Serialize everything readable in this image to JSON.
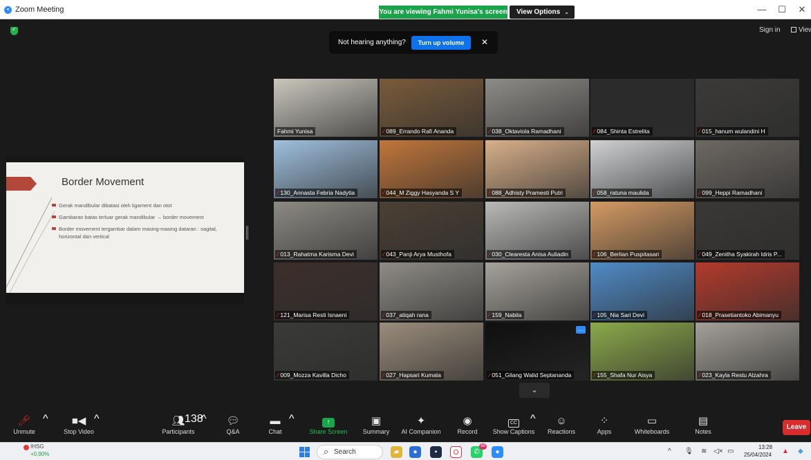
{
  "window": {
    "title": "Zoom Meeting",
    "minimize": "—",
    "maximize": "☐",
    "close": "✕"
  },
  "banner": {
    "viewing_text": "You are viewing Fahmi Yunisa's screen",
    "view_options_label": "View Options",
    "view_options_caret": "⌄"
  },
  "header": {
    "sign_in": "Sign in",
    "view": "View"
  },
  "notice": {
    "message": "Not hearing anything?",
    "button": "Turn up volume",
    "close": "✕"
  },
  "slide": {
    "title": "Border Movement",
    "bullets": [
      "Gerak mandibular dibatasi oleh ligament dan otot",
      "Gambaran batas terluar gerak mandibular → border movement",
      "Border movement tergambar dalam masing-masing dataran : sagital, horizontal dan vertical"
    ]
  },
  "participants": [
    {
      "name": "Fahmi Yunisa",
      "muted": false,
      "color": "#c9c6bd"
    },
    {
      "name": "089_Errando Rafi Ananda",
      "muted": true,
      "color": "#7a5b3b"
    },
    {
      "name": "038_Oktaviola Ramadhani",
      "muted": true,
      "color": "#8e8c88"
    },
    {
      "name": "084_Shinta Estrelita",
      "muted": true,
      "color": "#2b2b2b"
    },
    {
      "name": "015_hanum wulandini H",
      "muted": true,
      "color": "#3b3a38"
    },
    {
      "name": "130_Annasta Febria Nadytia",
      "muted": true,
      "color": "#9fc0de"
    },
    {
      "name": "044_M Ziggy Hasyanda S Y",
      "muted": true,
      "color": "#c1763a"
    },
    {
      "name": "088_Adhisty Pramesti Putri",
      "muted": true,
      "color": "#d9b08a"
    },
    {
      "name": "058_ratuna maulida",
      "muted": true,
      "color": "#cfd1d3"
    },
    {
      "name": "099_Heppi Ramadhani",
      "muted": true,
      "color": "#6d6863"
    },
    {
      "name": "013_Rahatma Karisma Devi",
      "muted": true,
      "color": "#8d8a84"
    },
    {
      "name": "043_Panji Arya Musthofa",
      "muted": true,
      "color": "#4b4034"
    },
    {
      "name": "030_Clearesta Anisa Auliadin",
      "muted": true,
      "color": "#b9b9b8"
    },
    {
      "name": "106_Berlian Puspitasari",
      "muted": true,
      "color": "#d49a63"
    },
    {
      "name": "049_Zenitha Syakirah Idris P...",
      "muted": true,
      "color": "#3a3836"
    },
    {
      "name": "121_Marisa Resti Isnaeni",
      "muted": true,
      "color": "#3d2f2b"
    },
    {
      "name": "037_atiqah rana",
      "muted": true,
      "color": "#8f8c86"
    },
    {
      "name": "159_Nabila",
      "muted": true,
      "color": "#a6a29b"
    },
    {
      "name": "105_Nia Sari Devi",
      "muted": true,
      "color": "#4f8bc7"
    },
    {
      "name": "018_Prasetiantoko Abimanyu",
      "muted": true,
      "color": "#b33a2c"
    },
    {
      "name": "009_Mozza Kavilla Dicho",
      "muted": true,
      "color": "#3a3a38"
    },
    {
      "name": "027_Hapsari Kumala",
      "muted": true,
      "color": "#9b8d7c"
    },
    {
      "name": "051_Gilang Walid Septananda",
      "muted": true,
      "color": "#0f0f0f"
    },
    {
      "name": "155_Shafa Nur Aisya",
      "muted": true,
      "color": "#8ba94a"
    },
    {
      "name": "023_Kayla Restu Alzahra",
      "muted": true,
      "color": "#a4a099"
    }
  ],
  "pager_icon": "⌄",
  "toolbar": {
    "unmute": "Unmute",
    "stop_video": "Stop Video",
    "participants": "Participants",
    "participants_count": "138",
    "qa": "Q&A",
    "chat": "Chat",
    "share_screen": "Share Screen",
    "summary": "Summary",
    "ai_companion": "AI Companion",
    "record": "Record",
    "show_captions": "Show Captions",
    "reactions": "Reactions",
    "apps": "Apps",
    "whiteboards": "Whiteboards",
    "notes": "Notes",
    "leave": "Leave",
    "caret": "^",
    "cc": "CC"
  },
  "taskbar": {
    "ticker_name": "IHSG",
    "ticker_value": "+0,90%",
    "search": "Search",
    "whatsapp_badge": "68",
    "time": "13:28",
    "date": "25/04/2024"
  },
  "colors": {
    "accent": "#0e72ed",
    "share_green": "#19a64b",
    "leave_red": "#d92d2d",
    "active_speaker": "#c3d64a",
    "muted_red": "#e02828"
  }
}
